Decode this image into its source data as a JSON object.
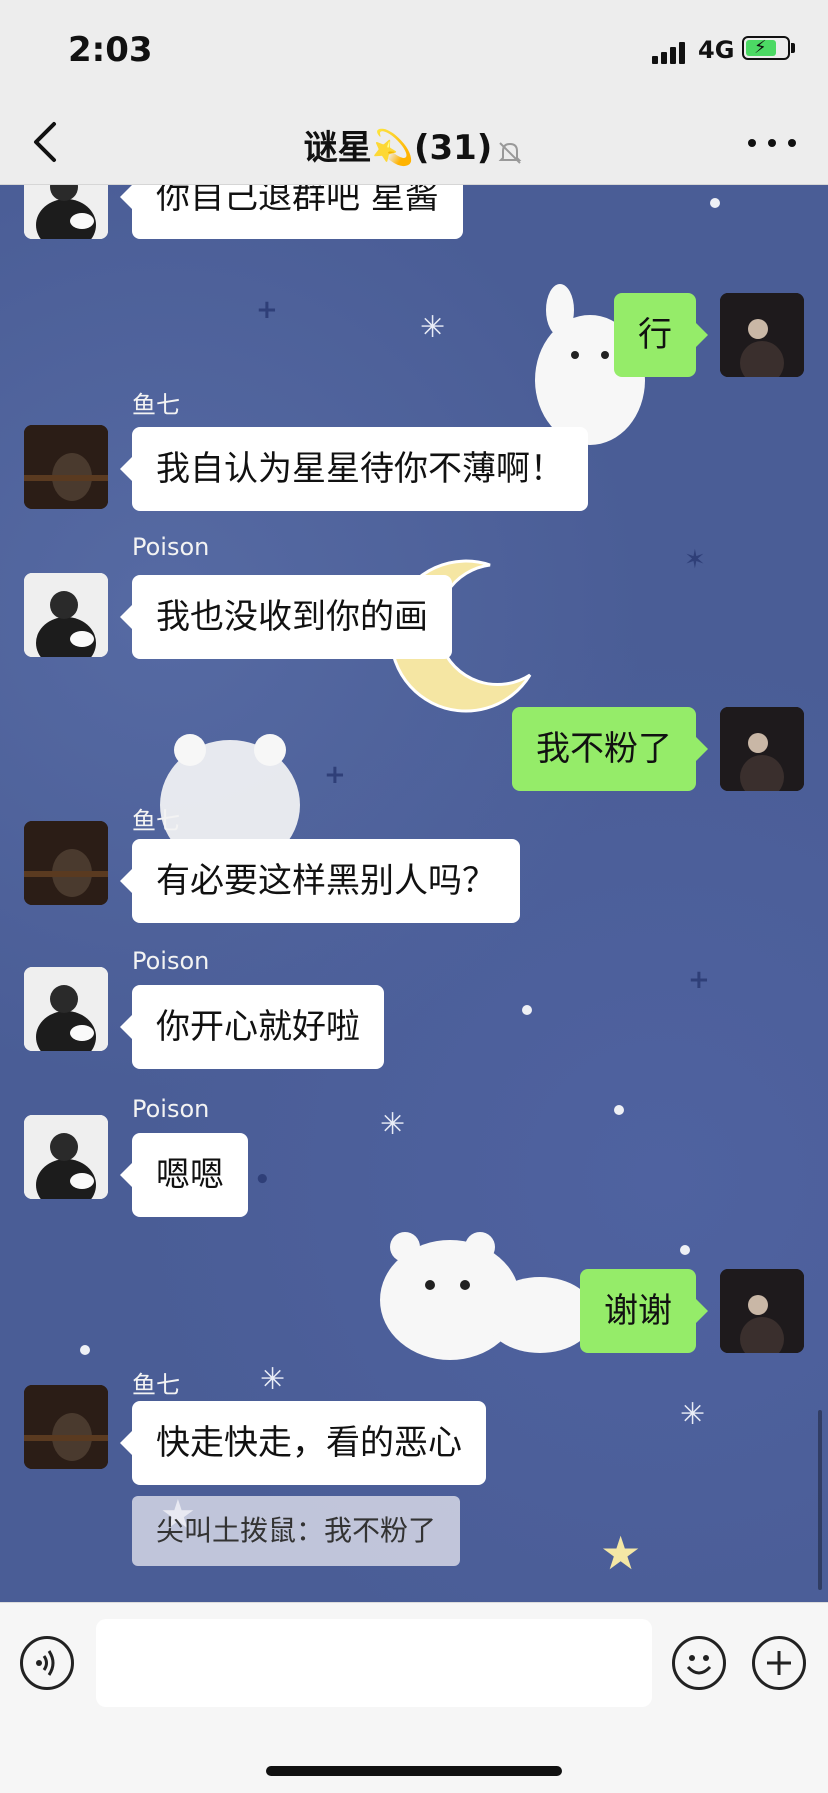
{
  "status": {
    "time": "2:03",
    "network": "4G"
  },
  "nav": {
    "title": "谜星💫(31)",
    "back_icon": "chevron-left-icon",
    "mute_icon": "bell-off-icon",
    "more_icon": "more-dots-icon"
  },
  "messages": [
    {
      "side": "in",
      "sender": "",
      "avatar": "poison",
      "text": "你自己退群吧 星酱"
    },
    {
      "side": "out",
      "text": "行"
    },
    {
      "side": "in",
      "sender": "鱼七",
      "avatar": "yuqi",
      "text": "我自认为星星待你不薄啊！"
    },
    {
      "side": "in",
      "sender": "Poison",
      "avatar": "poison",
      "text": "我也没收到你的画"
    },
    {
      "side": "out",
      "text": "我不粉了"
    },
    {
      "side": "in",
      "sender": "鱼七",
      "avatar": "yuqi",
      "text": "有必要这样黑别人吗？"
    },
    {
      "side": "in",
      "sender": "Poison",
      "avatar": "poison",
      "text": "你开心就好啦"
    },
    {
      "side": "in",
      "sender": "Poison",
      "avatar": "poison",
      "text": "嗯嗯"
    },
    {
      "side": "out",
      "text": "谢谢"
    },
    {
      "side": "in",
      "sender": "鱼七",
      "avatar": "yuqi",
      "text": "快走快走，看的恶心",
      "quote": "尖叫土拨鼠：我不粉了"
    }
  ],
  "input": {
    "placeholder": "",
    "voice_icon": "voice-icon",
    "emoji_icon": "emoji-icon",
    "add_icon": "plus-circle-icon"
  },
  "colors": {
    "bubble_out": "#95ec69",
    "bubble_in": "#ffffff",
    "chat_bg": "#4a5d96"
  }
}
